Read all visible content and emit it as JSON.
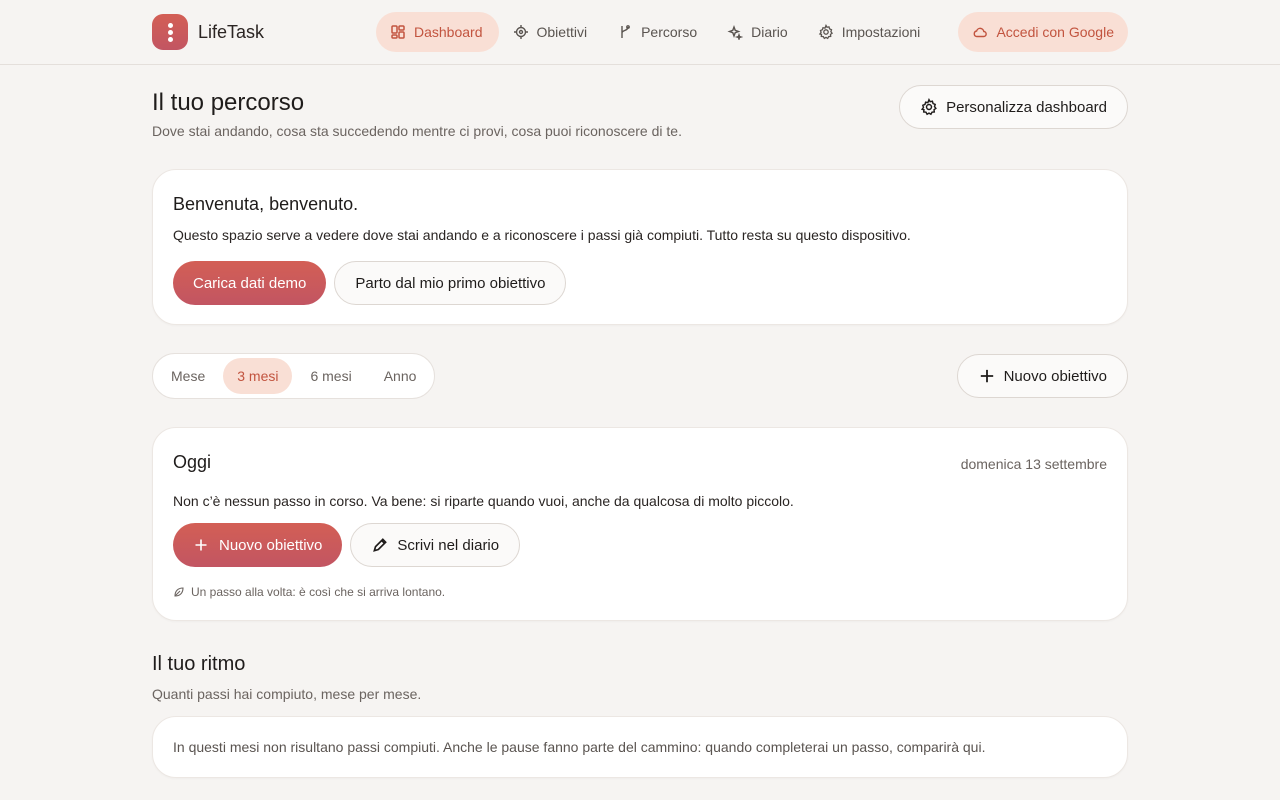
{
  "app": {
    "name": "LifeTask"
  },
  "nav": {
    "items": [
      {
        "label": "Dashboard",
        "icon": "dashboard-icon",
        "active": true
      },
      {
        "label": "Obiettivi",
        "icon": "target-icon",
        "active": false
      },
      {
        "label": "Percorso",
        "icon": "path-icon",
        "active": false
      },
      {
        "label": "Diario",
        "icon": "sparkle-icon",
        "active": false
      },
      {
        "label": "Impostazioni",
        "icon": "gear-icon",
        "active": false
      }
    ],
    "login_label": "Accedi con Google"
  },
  "header": {
    "title": "Il tuo percorso",
    "subtitle": "Dove stai andando, cosa sta succedendo mentre ci provi, cosa puoi riconoscere di te.",
    "customize_label": "Personalizza dashboard"
  },
  "welcome": {
    "title": "Benvenuta, benvenuto.",
    "text": "Questo spazio serve a vedere dove stai andando e a riconoscere i passi già compiuti. Tutto resta su questo dispositivo.",
    "demo_label": "Carica dati demo",
    "first_goal_label": "Parto dal mio primo obiettivo"
  },
  "periods": {
    "options": [
      "Mese",
      "3 mesi",
      "6 mesi",
      "Anno"
    ],
    "selected": "3 mesi"
  },
  "new_goal_label": "Nuovo obiettivo",
  "today": {
    "title": "Oggi",
    "date": "domenica 13 settembre",
    "text": "Non c’è nessun passo in corso. Va bene: si riparte quando vuoi, anche da qualcosa di molto piccolo.",
    "new_goal_label": "Nuovo obiettivo",
    "journal_label": "Scrivi nel diario",
    "hint": "Un passo alla volta: è così che si arriva lontano."
  },
  "rhythm": {
    "title": "Il tuo ritmo",
    "subtitle": "Quanti passi hai compiuto, mese per mese.",
    "empty_text": "In questi mesi non risultano passi compiuti. Anche le pause fanno parte del cammino: quando completerai un passo, comparirà qui."
  },
  "colors": {
    "accent": "#c2543f",
    "accent_bg": "#f9dfd5",
    "primary_gradient_start": "#d35f55",
    "primary_gradient_end": "#c25562"
  }
}
